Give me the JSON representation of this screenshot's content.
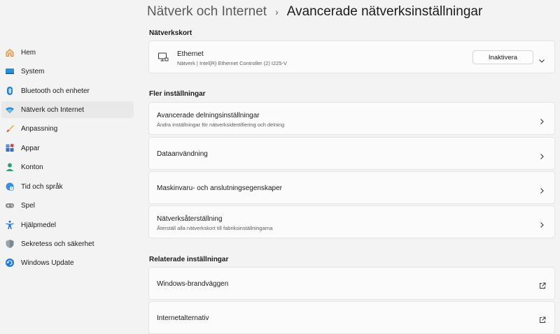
{
  "sidebar": {
    "items": [
      {
        "label": "Hem",
        "icon": "home-icon"
      },
      {
        "label": "System",
        "icon": "system-icon"
      },
      {
        "label": "Bluetooth och enheter",
        "icon": "bluetooth-icon"
      },
      {
        "label": "Nätverk och Internet",
        "icon": "network-icon",
        "active": true
      },
      {
        "label": "Anpassning",
        "icon": "brush-icon"
      },
      {
        "label": "Appar",
        "icon": "apps-icon"
      },
      {
        "label": "Konton",
        "icon": "account-icon"
      },
      {
        "label": "Tid och språk",
        "icon": "globe-clock-icon"
      },
      {
        "label": "Spel",
        "icon": "gamepad-icon"
      },
      {
        "label": "Hjälpmedel",
        "icon": "accessibility-icon"
      },
      {
        "label": "Sekretess och säkerhet",
        "icon": "shield-icon"
      },
      {
        "label": "Windows Update",
        "icon": "update-icon"
      }
    ]
  },
  "header": {
    "parent": "Nätverk och Internet",
    "separator": "›",
    "current": "Avancerade nätverksinställningar"
  },
  "network_adapters": {
    "section_title": "Nätverkskort",
    "adapter": {
      "name": "Ethernet",
      "description": "Nätverk | Intel(R) Ethernet Controller (2) I225-V",
      "button_label": "Inaktivera",
      "icon": "ethernet-icon"
    }
  },
  "more_settings": {
    "section_title": "Fler inställningar",
    "items": [
      {
        "title": "Avancerade delningsinställningar",
        "subtitle": "Ändra inställningar för nätverksidentifiering och delning"
      },
      {
        "title": "Dataanvändning",
        "subtitle": ""
      },
      {
        "title": "Maskinvaru- och anslutningsegenskaper",
        "subtitle": ""
      },
      {
        "title": "Nätverksåterställning",
        "subtitle": "Återställ alla nätverkskort till fabriksinställningarna"
      }
    ]
  },
  "related_settings": {
    "section_title": "Relaterade inställningar",
    "items": [
      {
        "title": "Windows-brandväggen"
      },
      {
        "title": "Internetalternativ"
      }
    ]
  },
  "colors": {
    "background": "#f3f3f3",
    "card": "#fbfbfb",
    "accent": "#0067c0",
    "active_nav": "#e9e9e9"
  }
}
